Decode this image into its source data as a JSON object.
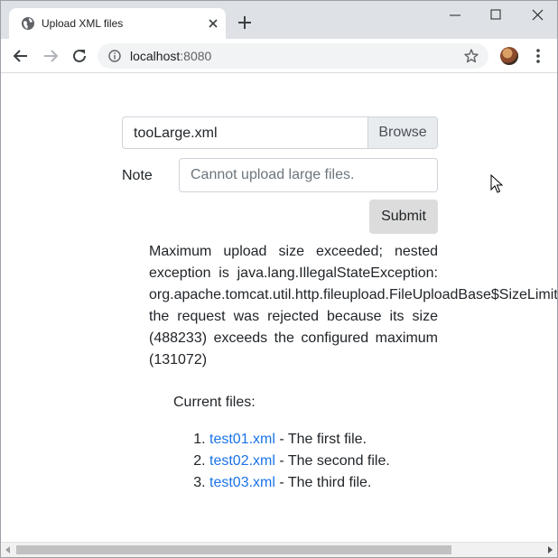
{
  "browser": {
    "tab_title": "Upload XML files",
    "url_host": "localhost",
    "url_port": ":8080"
  },
  "form": {
    "file_name": "tooLarge.xml",
    "browse_label": "Browse",
    "note_label": "Note",
    "note_placeholder": "Cannot upload large files.",
    "note_value": "",
    "submit_label": "Submit"
  },
  "error": {
    "message": "Maximum upload size exceeded; nested exception is java.lang.IllegalStateException: org.apache.tomcat.util.http.fileupload.FileUploadBase$SizeLimitExceededException: the request was rejected because its size (488233) exceeds the configured maximum (131072)"
  },
  "files": {
    "heading": "Current files:",
    "items": [
      {
        "name": "test01.xml",
        "sep": " - ",
        "desc": "The first file."
      },
      {
        "name": "test02.xml",
        "sep": " - ",
        "desc": "The second file."
      },
      {
        "name": "test03.xml",
        "sep": " - ",
        "desc": "The third file."
      }
    ]
  },
  "icons": {
    "favicon": "globe-icon",
    "close": "close-icon",
    "new_tab": "plus-icon",
    "info": "info-icon",
    "bookmark": "star-icon",
    "menu": "kebab-menu-icon"
  }
}
